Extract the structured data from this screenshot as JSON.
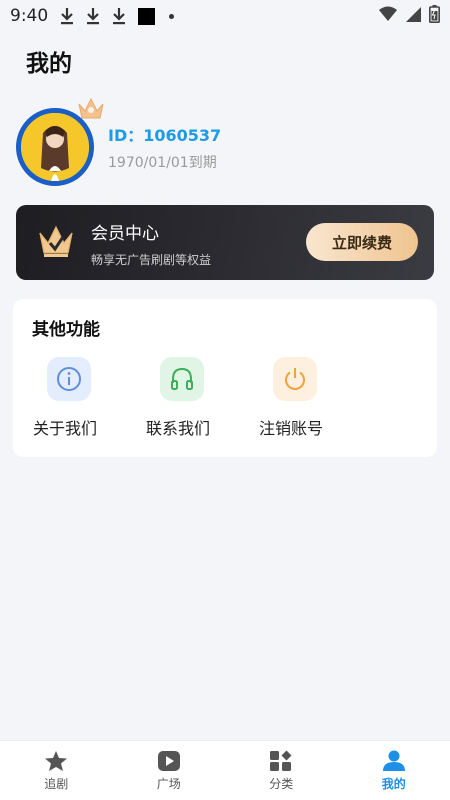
{
  "status_bar": {
    "time": "9:40"
  },
  "page": {
    "title": "我的"
  },
  "profile": {
    "user_id": "ID：1060537",
    "expire": "1970/01/01到期"
  },
  "vip": {
    "title": "会员中心",
    "subtitle": "畅享无广告刷剧等权益",
    "button_label": "立即续费"
  },
  "functions": {
    "title": "其他功能",
    "items": [
      {
        "label": "关于我们",
        "icon": "info-icon",
        "color": "#5d8fe0",
        "bg": "#e4edfd"
      },
      {
        "label": "联系我们",
        "icon": "headphones-icon",
        "color": "#3fae5a",
        "bg": "#e0f5e5"
      },
      {
        "label": "注销账号",
        "icon": "power-icon",
        "color": "#f2a23c",
        "bg": "#fdf0df"
      }
    ]
  },
  "nav": {
    "items": [
      {
        "label": "追剧",
        "icon": "star-icon"
      },
      {
        "label": "广场",
        "icon": "play-icon"
      },
      {
        "label": "分类",
        "icon": "category-icon"
      },
      {
        "label": "我的",
        "icon": "user-icon"
      }
    ],
    "active": "我的",
    "active_color": "#1e8fe6"
  }
}
